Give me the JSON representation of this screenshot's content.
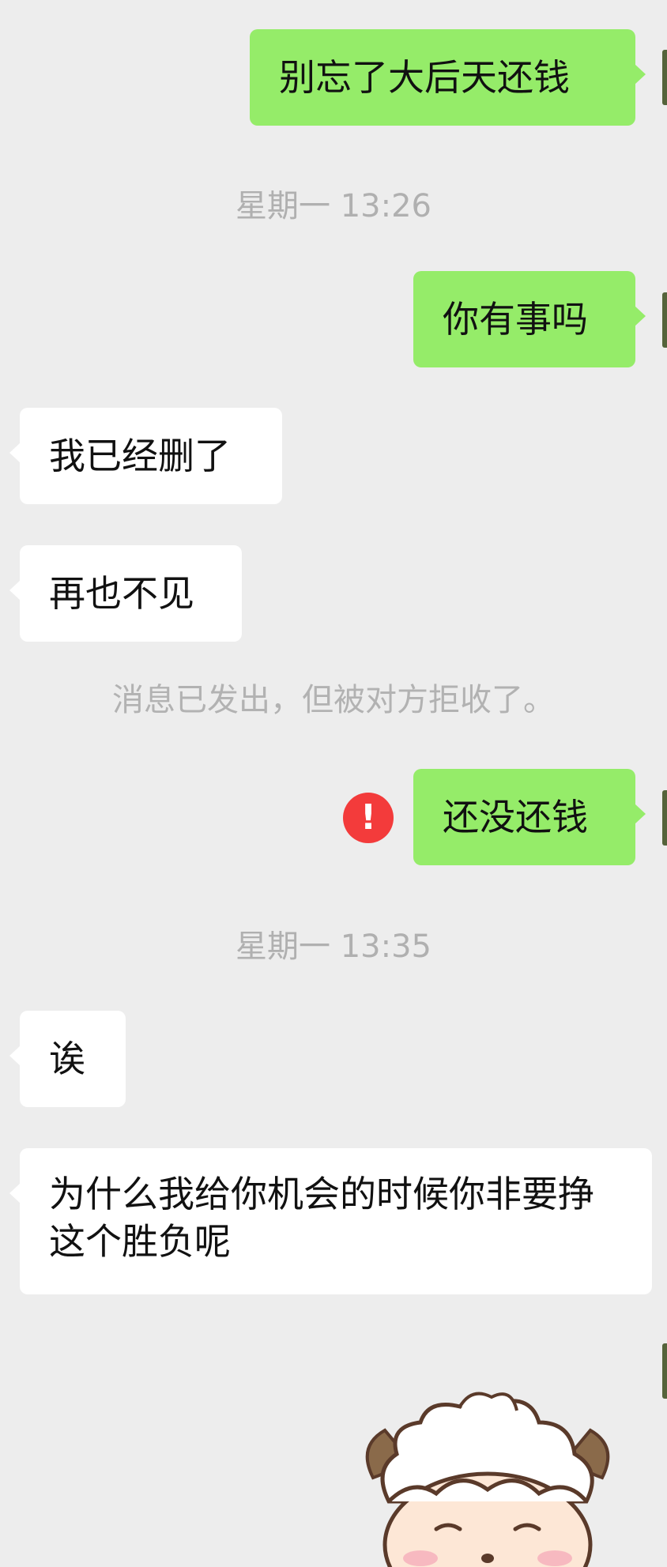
{
  "messages": [
    {
      "id": "m1",
      "text": "别忘了大后天还钱"
    },
    {
      "id": "m2",
      "text": "你有事吗"
    },
    {
      "id": "m3",
      "text": "我已经删了"
    },
    {
      "id": "m4",
      "text": "再也不见"
    },
    {
      "id": "m5",
      "text": "还没还钱"
    },
    {
      "id": "m6",
      "text": "诶"
    },
    {
      "id": "m7",
      "text": "为什么我给你机会的时候你非要挣这个胜负呢"
    }
  ],
  "timestamps": [
    "星期一 13:26",
    "星期一 13:35"
  ],
  "system_notice": "消息已发出，但被对方拒收了。",
  "error_glyph": "!",
  "sticker": {
    "icon": "lamb-sticker",
    "colors": {
      "wool": "#ffffff",
      "outline": "#5a3a2a",
      "ears": "#8a6a4a",
      "blush": "#f7b9c0",
      "face": "#fde7d6"
    }
  },
  "colors": {
    "background": "#ededed",
    "outgoing": "#95ec69",
    "incoming": "#ffffff",
    "error": "#f33b3b",
    "meta": "#b0b0b0"
  }
}
